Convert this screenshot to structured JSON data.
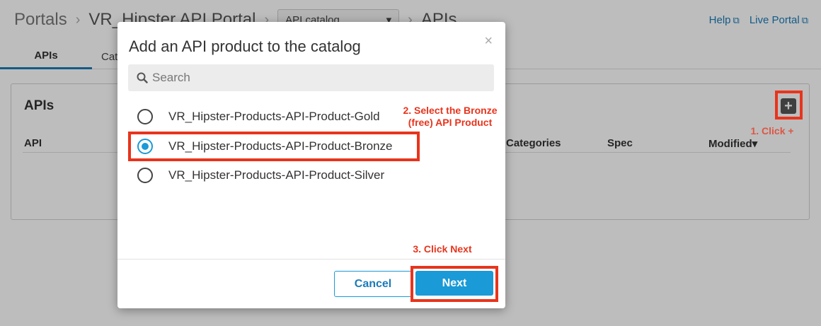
{
  "breadcrumb": {
    "root": "Portals",
    "portal": "VR_Hipster API Portal",
    "section_select": "API catalog",
    "current": "APIs"
  },
  "top_links": {
    "help": "Help",
    "live_portal": "Live Portal"
  },
  "tabs": [
    {
      "label": "APIs"
    },
    {
      "label": "Cat"
    }
  ],
  "card": {
    "title": "APIs",
    "columns": {
      "api": "API",
      "categories": "Categories",
      "spec": "Spec",
      "modified": "Modified"
    },
    "sort_indicator": "▾"
  },
  "modal": {
    "title": "Add an API product to the catalog",
    "close": "×",
    "search": {
      "placeholder": "Search",
      "value": ""
    },
    "options": [
      {
        "label": "VR_Hipster-Products-API-Product-Gold",
        "selected": false
      },
      {
        "label": "VR_Hipster-Products-API-Product-Bronze",
        "selected": true
      },
      {
        "label": "VR_Hipster-Products-API-Product-Silver",
        "selected": false
      }
    ],
    "cancel_label": "Cancel",
    "next_label": "Next"
  },
  "annotations": {
    "step1": "1. Click +",
    "step2_line1": "2. Select the Bronze",
    "step2_line2": "(free) API Product",
    "step3": "3. Click Next"
  },
  "colors": {
    "accent": "#1a9ad6",
    "annotation_red": "#e8341c",
    "link": "#1a7bb8"
  }
}
